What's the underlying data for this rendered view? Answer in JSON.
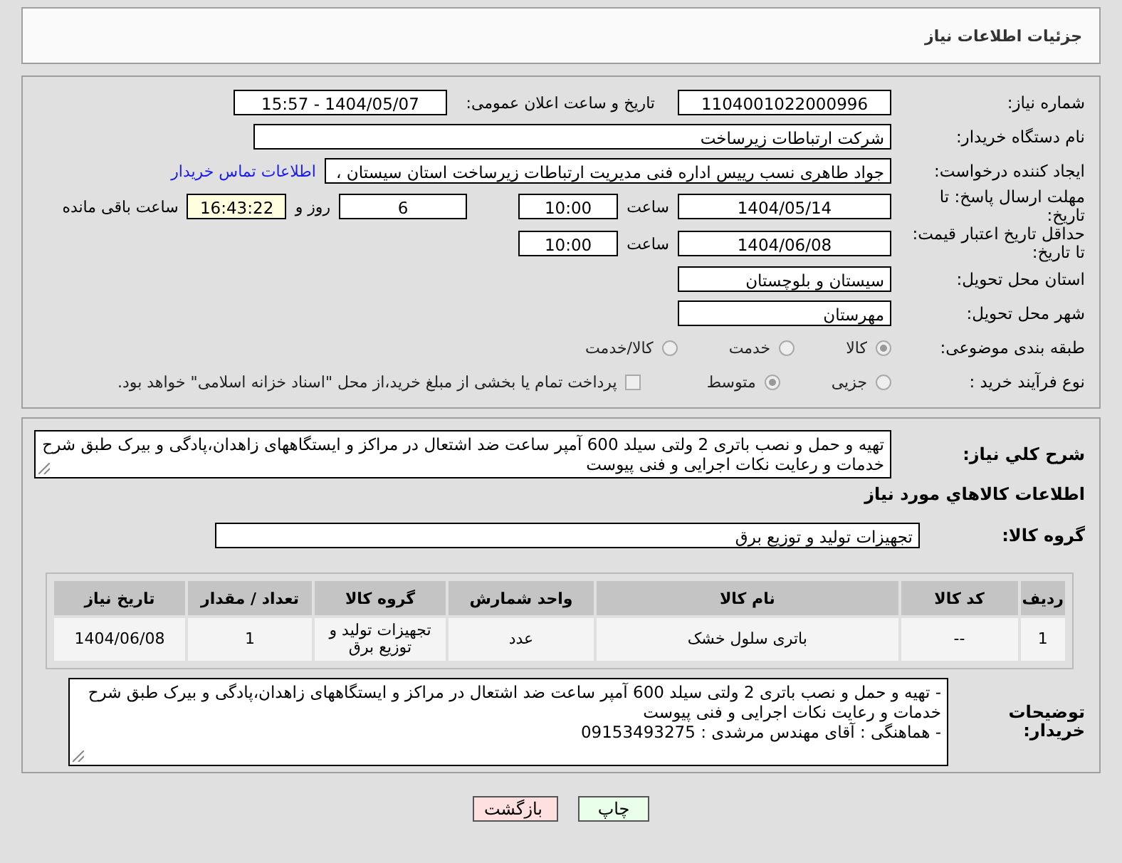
{
  "header": {
    "title": "جزئیات اطلاعات نیاز"
  },
  "need_number": {
    "label": "شماره نیاز:",
    "value": "1104001022000996"
  },
  "announce": {
    "label": "تاریخ و ساعت اعلان عمومی:",
    "value": "1404/05/07 - 15:57"
  },
  "buyer": {
    "label": "نام دستگاه خریدار:",
    "value": "شرکت ارتباطات زیرساخت"
  },
  "creator": {
    "label": "ایجاد کننده درخواست:",
    "value": "جواد طاهری نسب رییس اداره فنی مدیریت ارتباطات زیرساخت استان سیستان ،",
    "link": "اطلاعات تماس خریدار"
  },
  "reply_deadline": {
    "label": "مهلت ارسال پاسخ: تا تاریخ:",
    "date": "1404/05/14",
    "time_label": "ساعت",
    "time": "10:00",
    "days": "6",
    "days_label": "روز و",
    "remaining": "16:43:22",
    "remaining_label": "ساعت باقی مانده"
  },
  "price_validity": {
    "label": "حداقل تاریخ اعتبار قیمت: تا تاریخ:",
    "date": "1404/06/08",
    "time_label": "ساعت",
    "time": "10:00"
  },
  "province": {
    "label": "استان محل تحویل:",
    "value": "سیستان و بلوچستان"
  },
  "city": {
    "label": "شهر محل تحویل:",
    "value": "مهرستان"
  },
  "category": {
    "label": "طبقه بندی موضوعی:",
    "options": [
      {
        "label": "کالا",
        "selected": true
      },
      {
        "label": "خدمت",
        "selected": false
      },
      {
        "label": "کالا/خدمت",
        "selected": false
      }
    ]
  },
  "process": {
    "label": "نوع فرآیند خرید :",
    "options": [
      {
        "label": "جزیی",
        "selected": false
      },
      {
        "label": "متوسط",
        "selected": true
      }
    ],
    "payment": {
      "label": "پرداخت تمام یا بخشی از مبلغ خرید،از محل \"اسناد خزانه اسلامی\" خواهد بود.",
      "checked": false
    }
  },
  "description": {
    "label": "شرح کلي نياز:",
    "value": "تهیه و حمل و نصب باتری 2 ولتی سیلد 600 آمپر ساعت ضد اشتعال در مراکز و ایستگاههای زاهدان،پادگی و بیرک طبق شرح خدمات و رعایت نکات اجرایی و فنی پیوست"
  },
  "goods_title": "اطلاعات کالاهاي مورد نياز",
  "group": {
    "label": "گروه کالا:",
    "value": "تجهیزات تولید و توزیع برق"
  },
  "table": {
    "columns": [
      "ردیف",
      "کد کالا",
      "نام کالا",
      "واحد شمارش",
      "گروه کالا",
      "تعداد / مقدار",
      "تاریخ نیاز"
    ],
    "rows": [
      [
        "1",
        "--",
        "باتری سلول خشک",
        "عدد",
        "تجهیزات تولید و توزیع برق",
        "1",
        "1404/06/08"
      ]
    ]
  },
  "buyer_notes": {
    "label": "توضیحات خریدار:",
    "lines": [
      "- تهیه و حمل و نصب باتری 2 ولتی سیلد 600 آمپر ساعت ضد اشتعال در مراکز و ایستگاههای زاهدان،پادگی و بیرک طبق شرح خدمات و رعایت نکات اجرایی و فنی پیوست",
      "- هماهنگی : آقای مهندس مرشدی : 09153493275"
    ]
  },
  "buttons": [
    {
      "label": "چاپ",
      "kind": "print"
    },
    {
      "label": "بازگشت",
      "kind": "back"
    }
  ]
}
